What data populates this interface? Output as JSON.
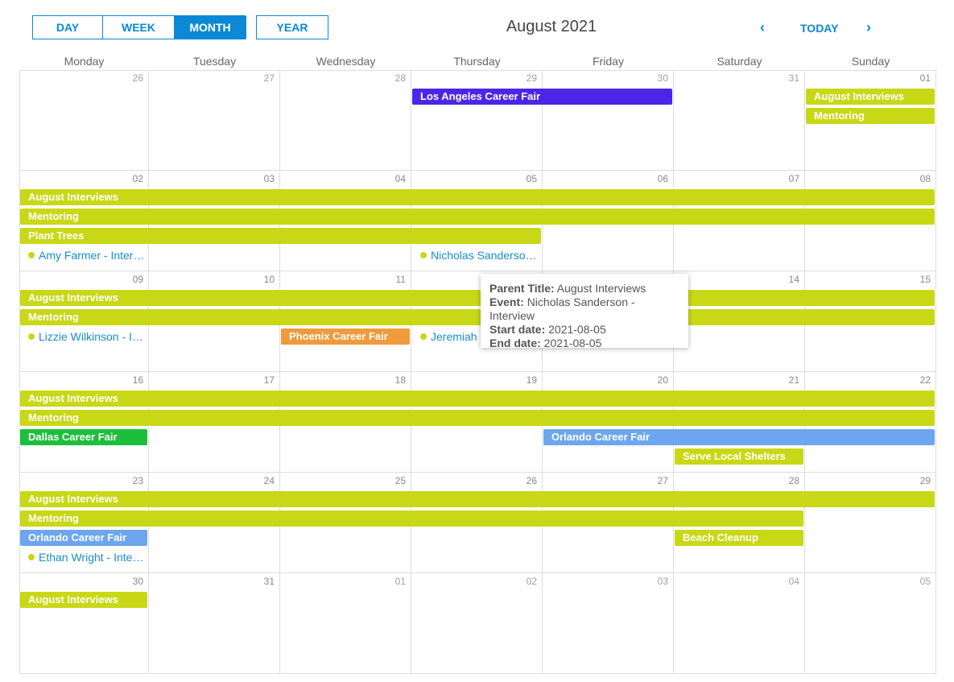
{
  "toolbar": {
    "views": [
      "DAY",
      "WEEK",
      "MONTH",
      "YEAR"
    ],
    "active": "MONTH",
    "title": "August 2021",
    "today": "TODAY",
    "prev_icon": "chevron-left-icon",
    "next_icon": "chevron-right-icon"
  },
  "day_names": [
    "Monday",
    "Tuesday",
    "Wednesday",
    "Thursday",
    "Friday",
    "Saturday",
    "Sunday"
  ],
  "weeks": [
    [
      "26",
      "27",
      "28",
      "29",
      "30",
      "31",
      "01"
    ],
    [
      "02",
      "03",
      "04",
      "05",
      "06",
      "07",
      "08"
    ],
    [
      "09",
      "10",
      "11",
      "12",
      "13",
      "14",
      "15"
    ],
    [
      "16",
      "17",
      "18",
      "19",
      "20",
      "21",
      "22"
    ],
    [
      "23",
      "24",
      "25",
      "26",
      "27",
      "28",
      "29"
    ],
    [
      "30",
      "31",
      "01",
      "02",
      "03",
      "04",
      "05"
    ]
  ],
  "colors": {
    "lime": "#c8d816",
    "purple": "#4b26e8",
    "orange": "#ef9a3c",
    "green": "#1cbf3b",
    "blue": "#6da6ef",
    "link": "#1a8bd1"
  },
  "events": [
    {
      "title": "Los Angeles Career Fair",
      "start": "2021-07-29",
      "end": "2021-07-30",
      "color": "purple",
      "kind": "bar"
    },
    {
      "title": "August Interviews",
      "start": "2021-08-01",
      "end": "2021-08-30",
      "color": "lime",
      "kind": "bar"
    },
    {
      "title": "Mentoring",
      "start": "2021-08-01",
      "end": "2021-08-28",
      "color": "lime",
      "kind": "bar"
    },
    {
      "title": "Plant Trees",
      "start": "2021-08-02",
      "end": "2021-08-05",
      "color": "lime",
      "kind": "bar"
    },
    {
      "title": "Amy Farmer - Interview",
      "start": "2021-08-02",
      "end": "2021-08-02",
      "color": "lime",
      "kind": "dot"
    },
    {
      "title": "Nicholas Sanderson - Interview",
      "start": "2021-08-05",
      "end": "2021-08-05",
      "color": "lime",
      "kind": "dot"
    },
    {
      "title": "Lizzie Wilkinson - Interview",
      "start": "2021-08-09",
      "end": "2021-08-09",
      "color": "lime",
      "kind": "dot"
    },
    {
      "title": "Phoenix Career Fair",
      "start": "2021-08-11",
      "end": "2021-08-11",
      "color": "orange",
      "kind": "bar"
    },
    {
      "title": "Jeremiah",
      "start": "2021-08-12",
      "end": "2021-08-12",
      "color": "lime",
      "kind": "dot"
    },
    {
      "title": "Dallas Career Fair",
      "start": "2021-08-16",
      "end": "2021-08-16",
      "color": "green",
      "kind": "bar"
    },
    {
      "title": "Orlando Career Fair",
      "start": "2021-08-20",
      "end": "2021-08-23",
      "color": "blue",
      "kind": "bar"
    },
    {
      "title": "Serve Local Shelters",
      "start": "2021-08-21",
      "end": "2021-08-21",
      "color": "lime",
      "kind": "bar"
    },
    {
      "title": "Beach Cleanup",
      "start": "2021-08-28",
      "end": "2021-08-28",
      "color": "lime",
      "kind": "bar"
    },
    {
      "title": "Ethan Wright - Interview",
      "start": "2021-08-23",
      "end": "2021-08-23",
      "color": "lime",
      "kind": "dot"
    }
  ],
  "tooltip": {
    "parent_label": "Parent Title:",
    "parent": "August Interviews",
    "event_label": "Event:",
    "event": "Nicholas Sanderson - Interview",
    "start_label": "Start date:",
    "start": "2021-08-05",
    "end_label": "End date:",
    "end": "2021-08-05"
  }
}
